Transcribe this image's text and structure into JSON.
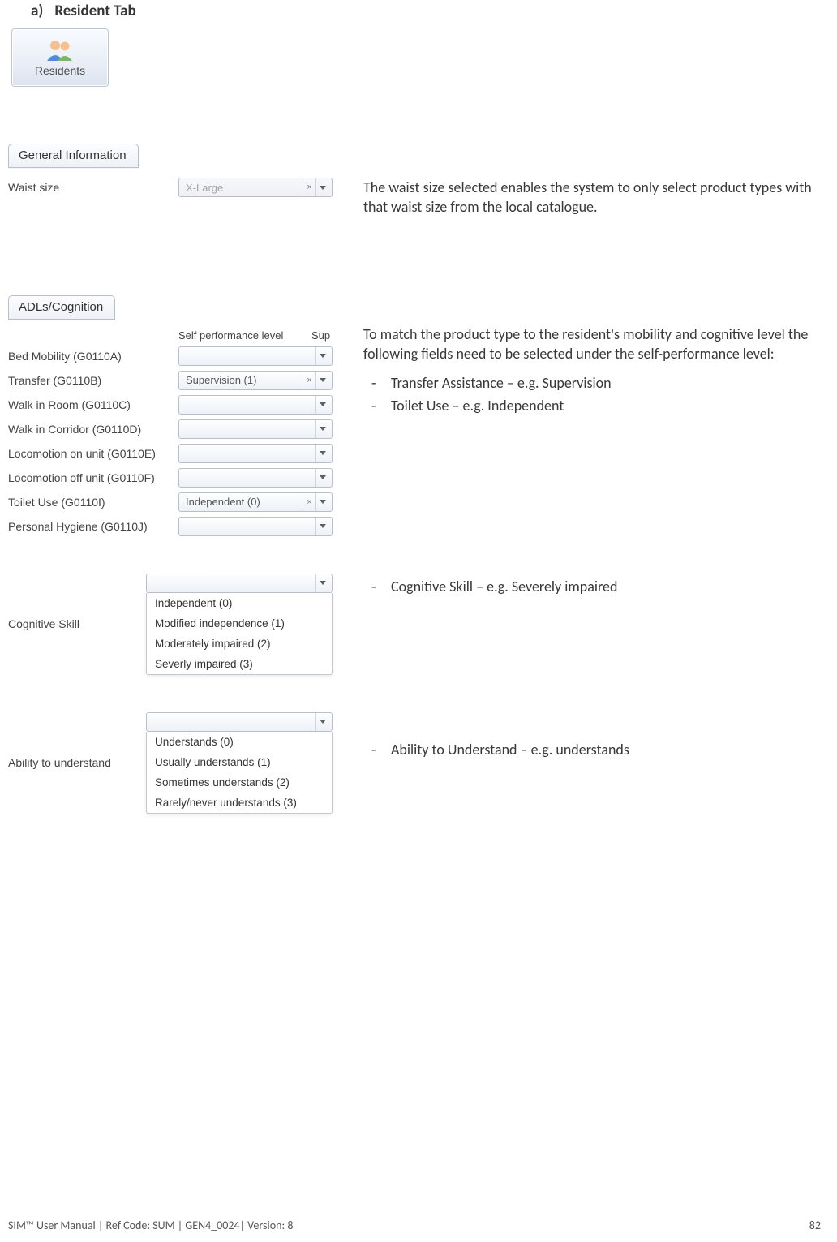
{
  "heading": {
    "marker": "a)",
    "title": "Resident Tab"
  },
  "ribbon": {
    "label": "Residents"
  },
  "general_info": {
    "tab_label": "General Information",
    "waist_label": "Waist size",
    "waist_value": "X-Large",
    "description": "The waist size selected enables the system to only select product types with that waist size from the local catalogue."
  },
  "adls": {
    "tab_label": "ADLs/Cognition",
    "header_self_perf": "Self performance level",
    "header_support": "Sup",
    "fields": [
      {
        "label": "Bed Mobility (G0110A)",
        "value": ""
      },
      {
        "label": "Transfer (G0110B)",
        "value": "Supervision (1)",
        "clearable": true
      },
      {
        "label": "Walk in Room (G0110C)",
        "value": ""
      },
      {
        "label": "Walk in Corridor (G0110D)",
        "value": ""
      },
      {
        "label": "Locomotion on unit (G0110E)",
        "value": ""
      },
      {
        "label": "Locomotion off unit (G0110F)",
        "value": ""
      },
      {
        "label": "Toilet Use (G0110I)",
        "value": "Independent (0)",
        "clearable": true
      },
      {
        "label": "Personal Hygiene (G0110J)",
        "value": ""
      }
    ],
    "intro": "To match the product type to the resident's mobility and cognitive level the following fields need to be selected under the self-performance level:",
    "bullets": [
      "Transfer Assistance – e.g. Supervision",
      "Toilet Use – e.g. Independent"
    ]
  },
  "cognitive": {
    "label": "Cognitive Skill",
    "options": [
      "Independent (0)",
      "Modified independence (1)",
      "Moderately impaired (2)",
      "Severly impaired (3)"
    ],
    "bullet": "Cognitive Skill – e.g. Severely impaired"
  },
  "understand": {
    "label": "Ability to understand",
    "options": [
      "Understands (0)",
      "Usually understands (1)",
      "Sometimes understands (2)",
      "Rarely/never understands (3)"
    ],
    "bullet": "Ability to Understand –  e.g. understands"
  },
  "footer": {
    "left": "SIM™ User Manual | Ref Code: SUM | GEN4_0024| Version: 8",
    "right": "82"
  }
}
